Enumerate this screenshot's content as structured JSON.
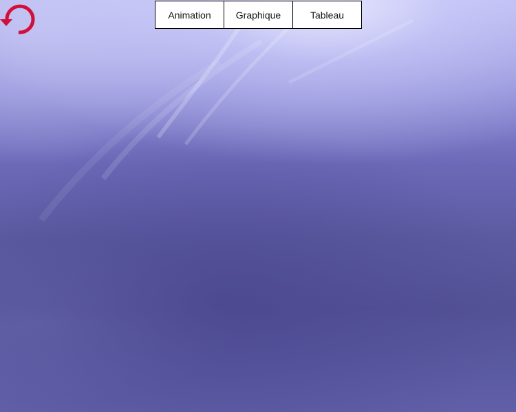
{
  "toolbar": {
    "reset_icon": "counterclockwise-refresh-icon",
    "reset_color": "#d0103a"
  },
  "tabs": [
    {
      "label": "Animation"
    },
    {
      "label": "Graphique"
    },
    {
      "label": "Tableau"
    }
  ],
  "colors": {
    "background_top": "#d6d6ff",
    "background_bottom": "#545296",
    "tab_background": "#ffffff",
    "tab_border": "#000000"
  }
}
